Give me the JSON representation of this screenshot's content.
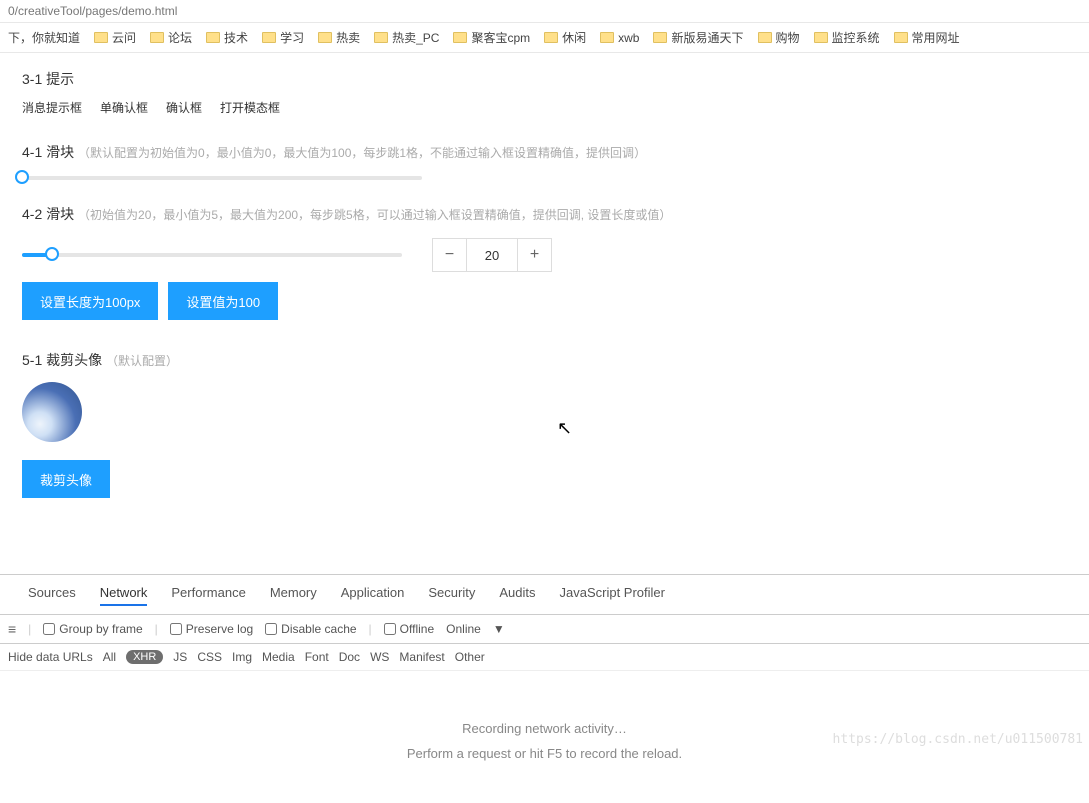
{
  "address_bar": "0/creativeTool/pages/demo.html",
  "bookmarks": [
    "下，你就知道",
    "云问",
    "论坛",
    "技术",
    "学习",
    "热卖",
    "热卖_PC",
    "聚客宝cpm",
    "休闲",
    "xwb",
    "新版易通天下",
    "购物",
    "监控系统",
    "常用网址"
  ],
  "sec3": {
    "title": "3-1 提示",
    "links": [
      "消息提示框",
      "单确认框",
      "确认框",
      "打开模态框"
    ]
  },
  "sec41": {
    "title": "4-1 滑块",
    "sub": "（默认配置为初始值为0，最小值为0，最大值为100，每步跳1格，不能通过输入框设置精确值，提供回调）"
  },
  "sec42": {
    "title": "4-2 滑块",
    "sub": "（初始值为20，最小值为5，最大值为200，每步跳5格，可以通过输入框设置精确值，提供回调, 设置长度或值）",
    "value": "20",
    "btn1": "设置长度为100px",
    "btn2": "设置值为100"
  },
  "sec5": {
    "title": "5-1 裁剪头像",
    "sub": "（默认配置）",
    "btn": "裁剪头像"
  },
  "devtools": {
    "tabs": [
      "Sources",
      "Network",
      "Performance",
      "Memory",
      "Application",
      "Security",
      "Audits",
      "JavaScript Profiler"
    ],
    "active_tab": "Network",
    "toolbar": {
      "group": "Group by frame",
      "preserve": "Preserve log",
      "disable": "Disable cache",
      "offline": "Offline",
      "online": "Online"
    },
    "filter": {
      "hide": "Hide data URLs",
      "all": "All",
      "xhr": "XHR",
      "types": [
        "JS",
        "CSS",
        "Img",
        "Media",
        "Font",
        "Doc",
        "WS",
        "Manifest",
        "Other"
      ]
    },
    "empty1": "Recording network activity…",
    "empty2": "Perform a request or hit F5 to record the reload."
  },
  "watermark": "https://blog.csdn.net/u011500781"
}
